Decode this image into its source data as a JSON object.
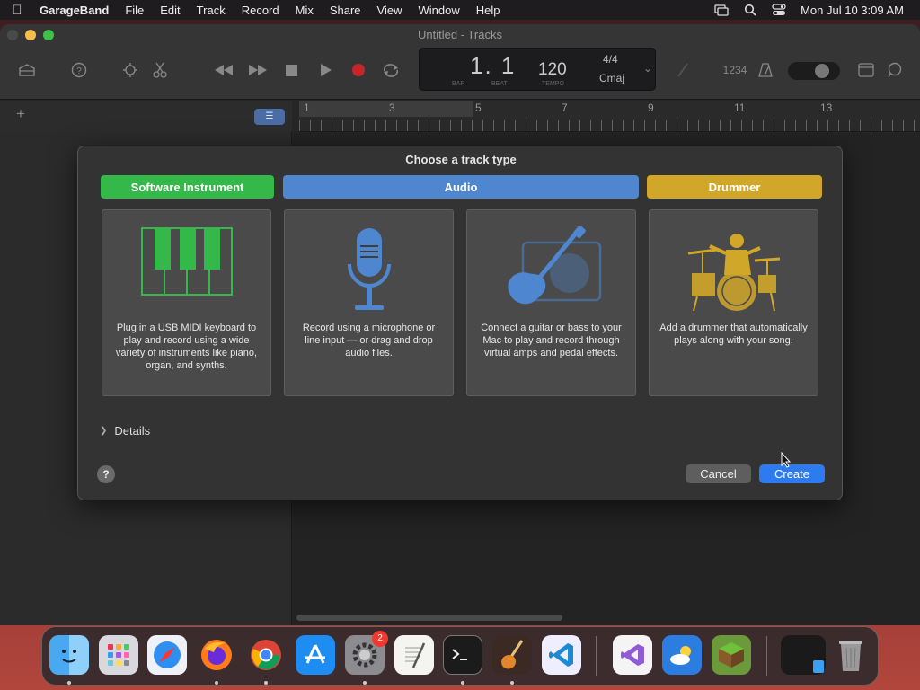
{
  "menubar": {
    "app": "GarageBand",
    "items": [
      "File",
      "Edit",
      "Track",
      "Record",
      "Mix",
      "Share",
      "View",
      "Window",
      "Help"
    ],
    "clock": "Mon Jul 10  3:09 AM"
  },
  "window": {
    "title": "Untitled - Tracks"
  },
  "lcd": {
    "position": "1. 1",
    "bar_label": "BAR",
    "beat_label": "BEAT",
    "tempo": "120",
    "tempo_label": "TEMPO",
    "time_signature": "4/4",
    "key": "Cmaj"
  },
  "toolbar": {
    "count_in": "1234"
  },
  "ruler": {
    "bars": [
      "1",
      "3",
      "5",
      "7",
      "9",
      "11",
      "13"
    ]
  },
  "dialog": {
    "title": "Choose a track type",
    "tabs": {
      "software_instrument": "Software Instrument",
      "audio": "Audio",
      "drummer": "Drummer"
    },
    "cards": [
      {
        "desc": "Plug in a USB MIDI keyboard to play and record using a wide variety of instruments like piano, organ, and synths."
      },
      {
        "desc": "Record using a microphone or line input — or drag and drop audio files."
      },
      {
        "desc": "Connect a guitar or bass to your Mac to play and record through virtual amps and pedal effects."
      },
      {
        "desc": "Add a drummer that automatically plays along with your song."
      }
    ],
    "details": "Details",
    "help": "?",
    "cancel": "Cancel",
    "create": "Create"
  },
  "dock": {
    "settings_badge": "2"
  },
  "colors": {
    "software_instrument": "#34b84a",
    "audio": "#4e87d0",
    "drummer": "#d1a72a",
    "create_button": "#2e7bf0"
  }
}
